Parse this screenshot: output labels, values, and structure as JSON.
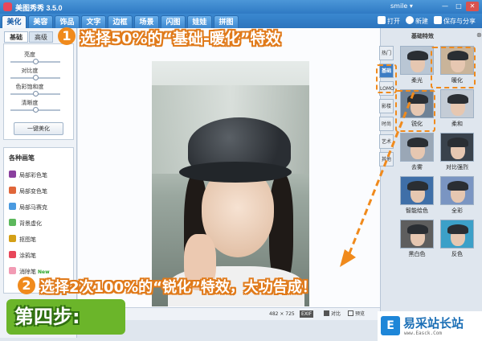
{
  "window": {
    "title": "美图秀秀 3.5.0",
    "user": "smile ▾",
    "controls": [
      "—",
      "□",
      "✕"
    ]
  },
  "tabs": [
    "美化",
    "美容",
    "饰品",
    "文字",
    "边框",
    "场景",
    "闪图",
    "娃娃",
    "拼图"
  ],
  "toolbar": {
    "open": "打开",
    "new": "新建",
    "save_share": "保存与分享"
  },
  "left_panel": {
    "subtabs": [
      "基础",
      "高级"
    ],
    "adjustments": [
      "亮度",
      "对比度",
      "色彩饱和度",
      "清晰度"
    ],
    "adjustment_levels": [
      0.5,
      0.5,
      0.5,
      0.5
    ],
    "one_key_button": "一键美化",
    "brush_title": "各种画笔",
    "brushes": [
      {
        "label": "局部彩色笔",
        "icon": "color-brush-icon",
        "color": "#8a3f9e"
      },
      {
        "label": "局部变色笔",
        "icon": "recolor-brush-icon",
        "color": "#e0663a"
      },
      {
        "label": "局部马赛克",
        "icon": "mosaic-icon",
        "color": "#4a9ae0"
      },
      {
        "label": "背景虚化",
        "icon": "blur-icon",
        "color": "#5cb85c"
      },
      {
        "label": "抠图笔",
        "icon": "cutout-icon",
        "color": "#d4a017"
      },
      {
        "label": "涂鸦笔",
        "icon": "doodle-icon",
        "color": "#e8475a"
      },
      {
        "label": "消除笔",
        "icon": "eraser-icon",
        "color": "#f29bb4",
        "badge": "New"
      }
    ]
  },
  "canvas": {
    "dimensions": "482 × 725",
    "exif": "EXIF",
    "compare": "对比",
    "preview": "预览"
  },
  "right_panel": {
    "title": "基础特效",
    "categories": [
      "热门",
      "基础",
      "LOMO",
      "影楼",
      "时尚",
      "艺术",
      "其他"
    ],
    "active_category": "基础",
    "effects": [
      "柔光",
      "暖化",
      "锐化",
      "柔和",
      "去雾",
      "对比强烈",
      "智能绘色",
      "全彩",
      "黑白色",
      "反色"
    ]
  },
  "annotations": {
    "step1_num": "1",
    "step1": "选择50%的“基础-暖化”特效",
    "step2_num": "2",
    "step2": "选择2次100%的“锐化”特效，大功告成！",
    "step_banner": "第四步:",
    "color": "#f08a1c"
  },
  "watermark": {
    "logo": "E",
    "name": "易采站长站",
    "url": "www.Easck.Com"
  }
}
